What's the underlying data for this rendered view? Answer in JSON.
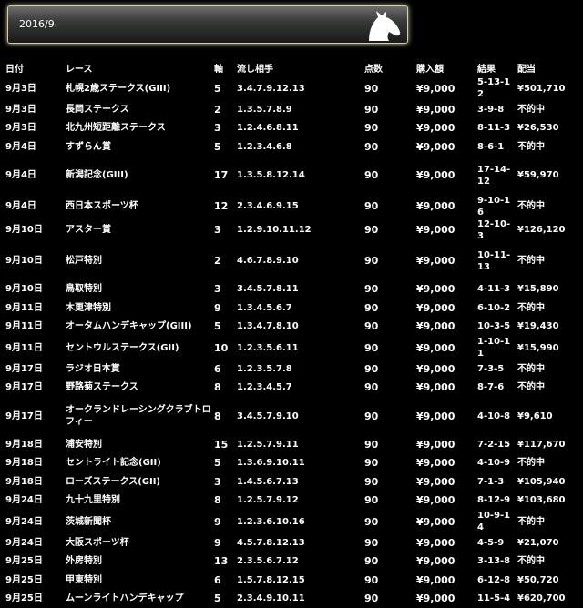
{
  "header": {
    "title": "2016/9"
  },
  "columns": [
    "日付",
    "レース",
    "軸",
    "流し相手",
    "点数",
    "購入額",
    "結果",
    "配当"
  ],
  "rows": [
    [
      "9月3日",
      "札幌2歳ステークス(GIII)",
      "5",
      "3.4.7.9.12.13",
      "90",
      "¥9,000",
      "5-13-12",
      "¥501,710"
    ],
    [
      "9月3日",
      "長岡ステークス",
      "2",
      "1.3.5.7.8.9",
      "90",
      "¥9,000",
      "3-9-8",
      "不的中"
    ],
    [
      "9月3日",
      "北九州短距離ステークス",
      "3",
      "1.2.4.6.8.11",
      "90",
      "¥9,000",
      "8-11-3",
      "¥26,530"
    ],
    [
      "9月4日",
      "すずらん賞",
      "5",
      "1.2.3.4.6.8",
      "90",
      "¥9,000",
      "8-6-1",
      "不的中"
    ],
    [
      "9月4日",
      "新潟記念(GIII)",
      "17",
      "1.3.5.8.12.14",
      "90",
      "¥9,000",
      "17-14-12",
      "¥59,970"
    ],
    [
      "9月4日",
      "西日本スポーツ杯",
      "12",
      "2.3.4.6.9.15",
      "90",
      "¥9,000",
      "9-10-16",
      "不的中"
    ],
    [
      "9月10日",
      "アスター賞",
      "3",
      "1.2.9.10.11.12",
      "90",
      "¥9,000",
      "12-10-3",
      "¥126,120"
    ],
    [
      "9月10日",
      "松戸特別",
      "2",
      "4.6.7.8.9.10",
      "90",
      "¥9,000",
      "10-11-13",
      "不的中"
    ],
    [
      "9月10日",
      "鳥取特別",
      "3",
      "3.4.5.7.8.11",
      "90",
      "¥9,000",
      "4-11-3",
      "¥15,890"
    ],
    [
      "9月11日",
      "木更津特別",
      "9",
      "1.3.4.5.6.7",
      "90",
      "¥9,000",
      "6-10-2",
      "不的中"
    ],
    [
      "9月11日",
      "オータムハンデキャップ(GIII)",
      "5",
      "1.3.4.7.8.10",
      "90",
      "¥9,000",
      "10-3-5",
      "¥19,430"
    ],
    [
      "9月11日",
      "セントウルステークス(GII)",
      "10",
      "1.2.3.5.6.11",
      "90",
      "¥9,000",
      "1-10-11",
      "¥15,990"
    ],
    [
      "9月17日",
      "ラジオ日本賞",
      "6",
      "1.2.3.5.7.8",
      "90",
      "¥9,000",
      "7-3-5",
      "不的中"
    ],
    [
      "9月17日",
      "野路菊ステークス",
      "8",
      "1.2.3.4.5.7",
      "90",
      "¥9,000",
      "8-7-6",
      "不的中"
    ],
    [
      "9月17日",
      "オークランドレーシングクラブトロフィー",
      "8",
      "3.4.5.7.9.10",
      "90",
      "¥9,000",
      "4-10-8",
      "¥9,610"
    ],
    [
      "9月18日",
      "浦安特別",
      "15",
      "1.2.5.7.9.11",
      "90",
      "¥9,000",
      "7-2-15",
      "¥117,670"
    ],
    [
      "9月18日",
      "セントライト記念(GII)",
      "5",
      "1.3.6.9.10.11",
      "90",
      "¥9,000",
      "4-10-9",
      "不的中"
    ],
    [
      "9月18日",
      "ローズステークス(GII)",
      "3",
      "1.4.5.6.7.13",
      "90",
      "¥9,000",
      "7-1-3",
      "¥105,940"
    ],
    [
      "9月24日",
      "九十九里特別",
      "8",
      "1.2.5.7.9.12",
      "90",
      "¥9,000",
      "8-12-9",
      "¥103,680"
    ],
    [
      "9月24日",
      "茨城新聞杯",
      "9",
      "1.2.3.6.10.16",
      "90",
      "¥9,000",
      "10-9-14",
      "不的中"
    ],
    [
      "9月24日",
      "大阪スポーツ杯",
      "9",
      "4.5.7.8.12.13",
      "90",
      "¥9,000",
      "4-5-9",
      "¥21,070"
    ],
    [
      "9月25日",
      "外房特別",
      "13",
      "2.3.5.6.7.12",
      "90",
      "¥9,000",
      "3-13-8",
      "不的中"
    ],
    [
      "9月25日",
      "甲東特別",
      "6",
      "1.5.7.8.12.15",
      "90",
      "¥9,000",
      "6-12-8",
      "¥50,720"
    ],
    [
      "9月25日",
      "ムーンライトハンデキャップ",
      "5",
      "2.3.4.9.10.11",
      "90",
      "¥9,000",
      "11-5-4",
      "¥620,700"
    ]
  ]
}
